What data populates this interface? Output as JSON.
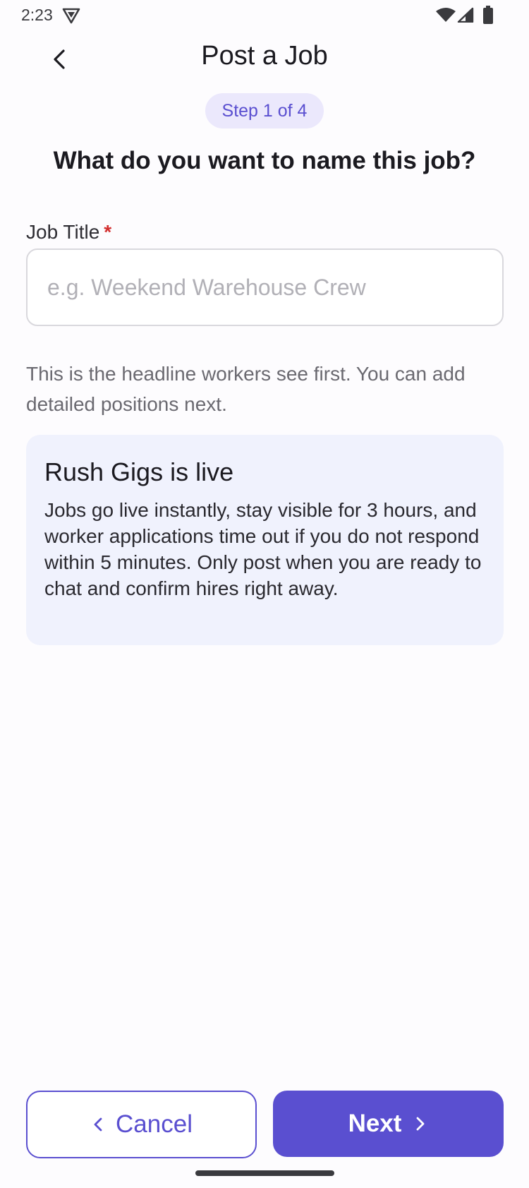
{
  "status_bar": {
    "time": "2:23",
    "icons": [
      "app-notification-icon",
      "wifi-icon",
      "signal-icon",
      "battery-icon"
    ]
  },
  "header": {
    "title": "Post a Job",
    "back_icon": "chevron-left-icon"
  },
  "step_badge": "Step 1 of 4",
  "question": "What do you want to name this job?",
  "job_title_field": {
    "label": "Job Title",
    "required_mark": "*",
    "value": "",
    "placeholder": "e.g. Weekend Warehouse Crew"
  },
  "helper_text": "This is the headline workers see first. You can add detailed positions next.",
  "info_card": {
    "title": "Rush Gigs is live",
    "body": "Jobs go live instantly, stay visible for 3 hours, and worker applications time out if you do not respond within 5 minutes. Only post when you are ready to chat and confirm hires right away."
  },
  "footer": {
    "cancel_label": "Cancel",
    "next_label": "Next"
  },
  "colors": {
    "accent": "#5a4fd0",
    "badge_bg": "#ebe8fc",
    "card_bg": "#f0f2fd",
    "required": "#d32f2f"
  }
}
